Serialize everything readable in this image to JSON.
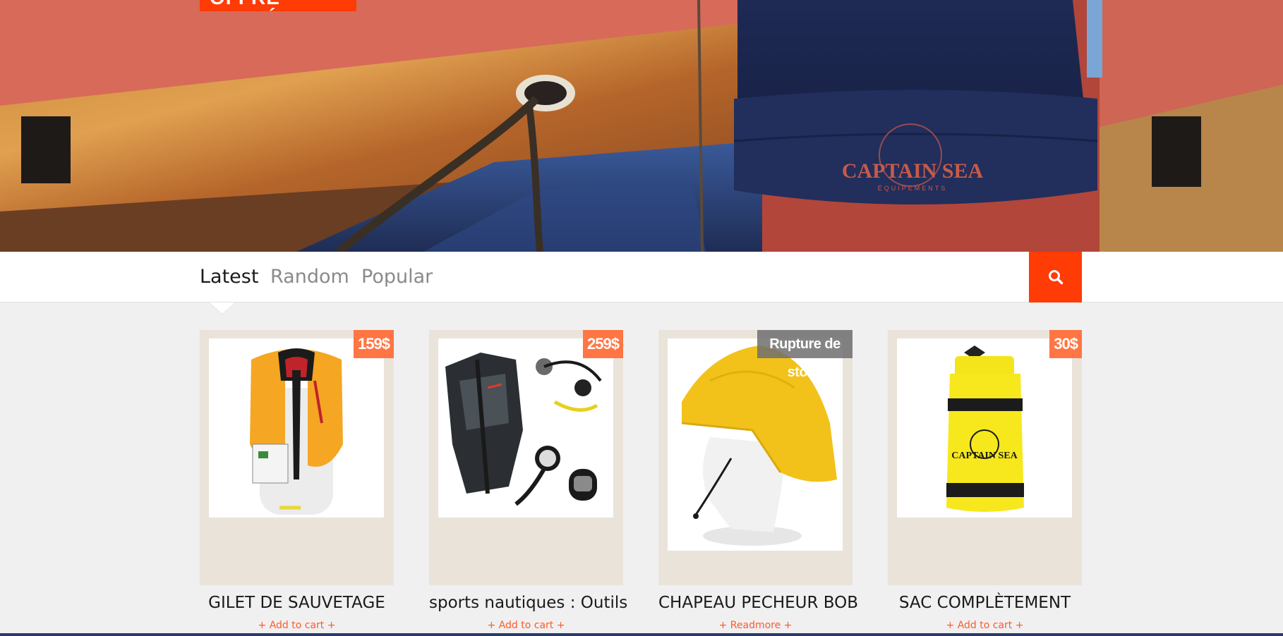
{
  "hero": {
    "promo_label": "OFFRE LIMITÉE",
    "brand_on_beanie": "CAPTAIN SEA",
    "brand_sub": "ÉQUIPEMENTS"
  },
  "tabs": [
    {
      "label": "Latest",
      "active": true
    },
    {
      "label": "Random",
      "active": false
    },
    {
      "label": "Popular",
      "active": false
    }
  ],
  "search": {
    "icon": "search-icon"
  },
  "colors": {
    "accent": "#ff3b06",
    "price_badge": "#ff7543",
    "card_bg": "#eae3da",
    "link": "#ff5a2a"
  },
  "products": [
    {
      "title": "GILET DE SAUVETAGE",
      "badge": "159$",
      "action": "+ Add to cart +",
      "image": "life-jacket"
    },
    {
      "title": "sports nautiques : Outils",
      "badge": "259$",
      "action": "+ Add to cart +",
      "image": "diving-gear"
    },
    {
      "title": "CHAPEAU PECHEUR BOB",
      "badge": "Rupture de stock",
      "action": "+ Readmore +",
      "image": "fisherman-hat"
    },
    {
      "title": "SAC COMPLÈTEMENT",
      "badge": "30$",
      "action": "+ Add to cart +",
      "image": "dry-bag"
    }
  ]
}
